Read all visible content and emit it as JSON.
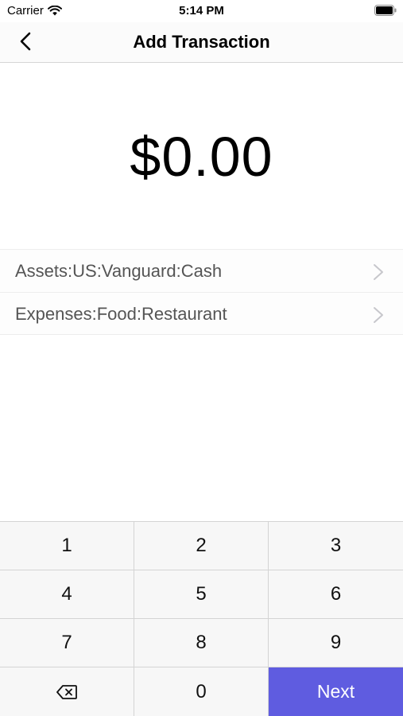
{
  "status_bar": {
    "carrier": "Carrier",
    "time": "5:14 PM"
  },
  "nav": {
    "title": "Add Transaction"
  },
  "amount": "$0.00",
  "accounts": [
    {
      "label": "Assets:US:Vanguard:Cash"
    },
    {
      "label": "Expenses:Food:Restaurant"
    }
  ],
  "keypad": {
    "k1": "1",
    "k2": "2",
    "k3": "3",
    "k4": "4",
    "k5": "5",
    "k6": "6",
    "k7": "7",
    "k8": "8",
    "k9": "9",
    "k0": "0",
    "next": "Next"
  },
  "colors": {
    "accent": "#5f5ce0"
  },
  "icons": {
    "back": "chevron-left-icon",
    "row": "chevron-right-icon",
    "delete": "backspace-icon"
  }
}
